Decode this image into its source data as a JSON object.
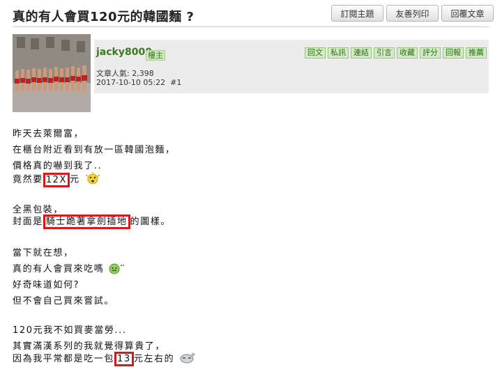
{
  "thread": {
    "title": "真的有人會買120元的韓國麵 ?"
  },
  "toolbar": {
    "subscribe": "訂閱主題",
    "print": "友善列印",
    "reply": "回覆文章"
  },
  "post": {
    "username": "jacky8000",
    "floor_badge": "樓主",
    "popularity_label": "文章人氣: 2,398",
    "timestamp": "2017-10-10 05:22",
    "post_number": "#1",
    "actions": [
      "回文",
      "私訊",
      "連結",
      "引言",
      "收藏",
      "評分",
      "回報",
      "推薦"
    ]
  },
  "body": {
    "p1_l1": "昨天去萊爾富，",
    "p1_l2": "在櫃台附近看到有放一區韓國泡麵，",
    "p1_l3": "價格真的嚇到我了..",
    "p1_l4_pre": "竟然要",
    "p1_l4_hl": "12X",
    "p1_l4_post": "元",
    "p2_l1": "全黑包裝，",
    "p2_l2_pre": "封面是",
    "p2_l2_hl": "騎士跪著拿劍插地",
    "p2_l2_post": "的圖樣。",
    "p3_l1": "當下就在想，",
    "p3_l2": "真的有人會買來吃嗎",
    "p3_l3": "好奇味道如何?",
    "p3_l4": "但不會自己買來嘗試。",
    "p4_l1": "120元我不如買麥當勞...",
    "p4_l2": "其實滿漢系列的我就覺得算貴了，",
    "p4_l3_pre": "因為我平常都是吃一包",
    "p4_l3_hl": "13",
    "p4_l3_post": "元左右的"
  },
  "colors": {
    "username": "#3a7a1e",
    "highlight_box": "#d7191c",
    "header_bg": "#ececec"
  },
  "icons": [
    "surprised-emoticon",
    "sweat-emoticon",
    "sleepy-emoticon"
  ]
}
